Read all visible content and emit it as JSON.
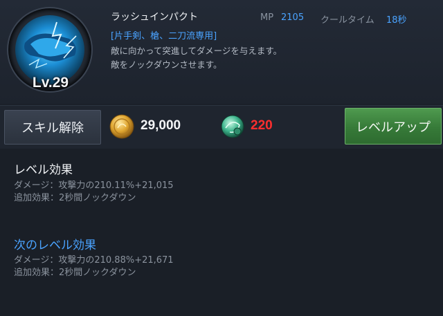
{
  "skill": {
    "name": "ラッシュインパクト",
    "level": "Lv.29",
    "icon": "rush-impact-skill-icon",
    "mp_label": "MP",
    "mp_value": "2105",
    "cooldown_label": "クールタイム",
    "cooldown_value": "18秒",
    "weapon_requirement": "[片手剣、槍、二刀流専用]",
    "description": [
      "敵に向かって突進してダメージを与えます。",
      "敵をノックダウンさせます。"
    ]
  },
  "actions": {
    "release_label": "スキル解除",
    "gold_icon": "gold-coin-icon",
    "gold_cost": "29,000",
    "gem_icon": "green-token-icon",
    "gem_cost": "220",
    "levelup_label": "レベルアップ"
  },
  "current_effect": {
    "title": "レベル効果",
    "lines": [
      "ダメージ：攻撃力の210.11%+21,015",
      "追加効果：2秒間ノックダウン"
    ]
  },
  "next_effect": {
    "title": "次のレベル効果",
    "lines": [
      "ダメージ：攻撃力の210.88%+21,671",
      "追加効果：2秒間ノックダウン"
    ]
  },
  "colors": {
    "accent_blue": "#4aa3ff",
    "cost_insufficient_red": "#ff2e2e",
    "levelup_green": "#367a38"
  }
}
